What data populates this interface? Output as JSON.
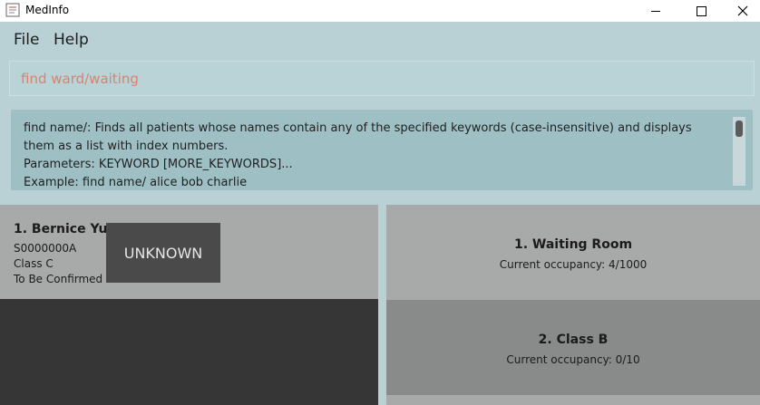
{
  "window": {
    "title": "MedInfo"
  },
  "menu": {
    "file": "File",
    "help": "Help"
  },
  "command": {
    "text": "find ward/waiting"
  },
  "result": {
    "text": "find name/: Finds all patients whose names contain any of the specified keywords (case-insensitive) and displays them as a list with index numbers.\nParameters: KEYWORD [MORE_KEYWORDS]...\nExample: find name/ alice bob charlie"
  },
  "patients": [
    {
      "index_name": "1.  Bernice Yu",
      "nric": "S0000000A",
      "class": "Class C",
      "ward": "To Be Confirmed",
      "status": "UNKNOWN"
    }
  ],
  "wards": [
    {
      "index_name": "1.  Waiting Room",
      "occupancy": "Current occupancy: 4/1000"
    },
    {
      "index_name": "2.  Class B",
      "occupancy": "Current occupancy: 0/10"
    }
  ],
  "colors": {
    "command_text": "#d9826f",
    "accent": "#b9d1d4"
  }
}
